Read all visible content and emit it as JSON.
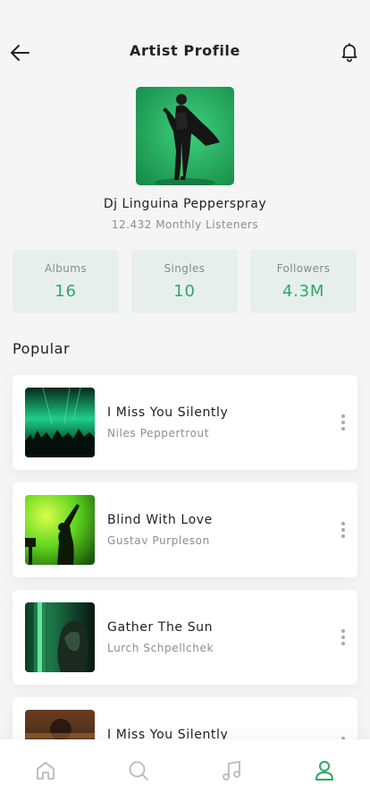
{
  "header": {
    "title": "Artist Profile",
    "back_icon": "arrow-left-icon",
    "notification_icon": "bell-icon"
  },
  "artist": {
    "name": "Dj Linguina Pepperspray",
    "listeners": "12.432 Monthly Listeners"
  },
  "stats": [
    {
      "label": "Albums",
      "value": "16"
    },
    {
      "label": "Singles",
      "value": "10"
    },
    {
      "label": "Followers",
      "value": "4.3M"
    }
  ],
  "popular": {
    "title": "Popular",
    "tracks": [
      {
        "title": "I Miss You Silently",
        "artist": "Niles Peppertrout"
      },
      {
        "title": "Blind With Love",
        "artist": "Gustav Purpleson"
      },
      {
        "title": "Gather The Sun",
        "artist": "Lurch Schpellchek"
      },
      {
        "title": "I Miss You Silently",
        "artist": ""
      }
    ]
  },
  "nav": {
    "items": [
      {
        "icon": "home-icon"
      },
      {
        "icon": "search-icon"
      },
      {
        "icon": "music-note-icon"
      },
      {
        "icon": "profile-icon",
        "active": true
      }
    ]
  },
  "colors": {
    "accent": "#2fa766",
    "stat_bg": "#e7efec",
    "background": "#f5f5f5",
    "muted_text": "#8d8d8d",
    "inactive_icon": "#b9b9b9"
  }
}
